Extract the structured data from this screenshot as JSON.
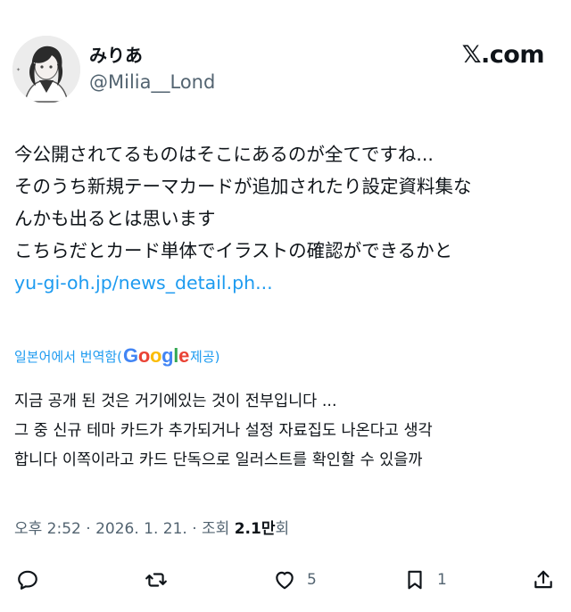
{
  "author": {
    "display_name": "みりあ",
    "handle": "@Milia__Lond"
  },
  "brand": "𝕏.com",
  "tweet_lines": [
    "今公開されてるものはそこにあるのが全てですね...",
    "そのうち新規テーマカードが追加されたり設定資料集な",
    "んかも出るとは思います",
    "こちらだとカード単体でイラストの確認ができるかと"
  ],
  "tweet_link": "yu-gi-oh.jp/news_detail.ph...",
  "translation": {
    "prefix": "일본어에서 번역함(",
    "google": "Google",
    "suffix": " 제공)",
    "lines": [
      "지금 공개 된 것은 거기에있는 것이 전부입니다 ...",
      "그 중 신규 테마 카드가 추가되거나 설정 자료집도 나온다고 생각",
      "합니다 이쪽이라고 카드 단독으로 일러스트를 확인할 수 있을까"
    ]
  },
  "meta": {
    "time": "오후 2:52 · 2026. 1. 21. · 조회 ",
    "views": "2.1만",
    "views_suffix": "회"
  },
  "actions": {
    "reply_icon": "reply-icon",
    "retweet_icon": "retweet-icon",
    "like_icon": "heart-icon",
    "like_count": "5",
    "bookmark_icon": "bookmark-icon",
    "bookmark_count": "1",
    "share_icon": "share-icon"
  }
}
